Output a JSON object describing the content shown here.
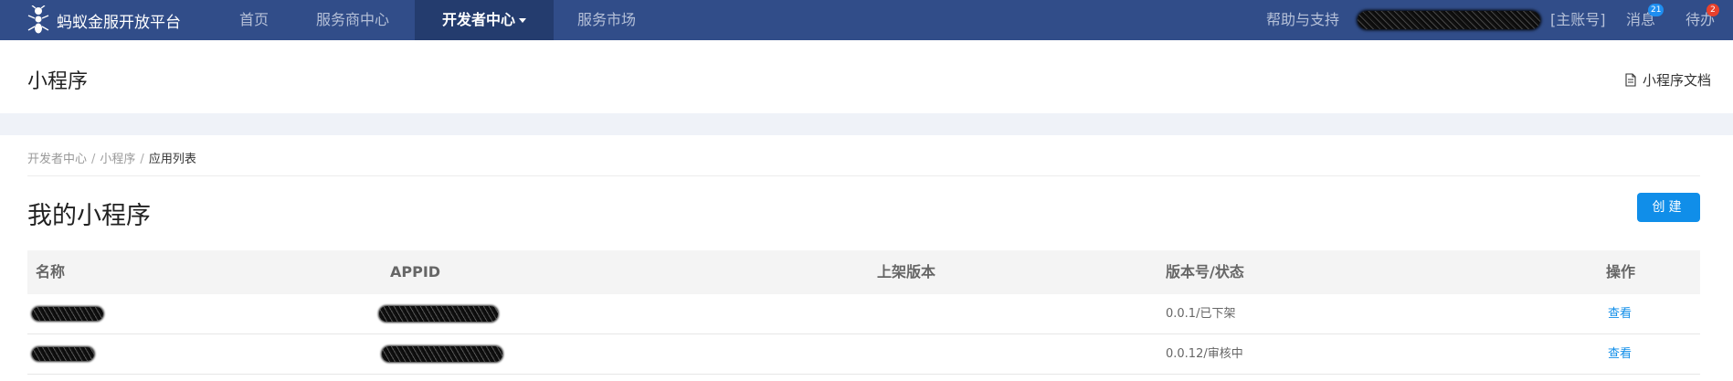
{
  "topnav": {
    "logo_text": "蚂蚁金服开放平台",
    "items": [
      {
        "label": "首页"
      },
      {
        "label": "服务商中心"
      },
      {
        "label": "开发者中心"
      },
      {
        "label": "服务市场"
      }
    ],
    "help": "帮助与支持",
    "account_tag": "[主账号]",
    "messages": {
      "label": "消息",
      "count": "21"
    },
    "todo": {
      "label": "待办",
      "count": "2"
    }
  },
  "page": {
    "title": "小程序",
    "doc_link": "小程序文档"
  },
  "breadcrumb": {
    "items": [
      "开发者中心",
      "小程序"
    ],
    "separator": "/",
    "current": "应用列表"
  },
  "section": {
    "title": "我的小程序",
    "create_label": "创建"
  },
  "table": {
    "columns": [
      "名称",
      "APPID",
      "上架版本",
      "版本号/状态",
      "操作"
    ],
    "rows": [
      {
        "name": "",
        "appid": "",
        "online_version": "",
        "version_status": "0.0.1/已下架",
        "action": "查看"
      },
      {
        "name": "",
        "appid": "",
        "online_version": "",
        "version_status": "0.0.12/审核中",
        "action": "查看"
      }
    ]
  },
  "colors": {
    "nav_bg": "#314d89",
    "nav_active_bg": "#243c6e",
    "primary": "#108ee9",
    "badge_blue": "#1e8ef0",
    "badge_red": "#e8412d",
    "band_bg": "#eff2f8"
  }
}
